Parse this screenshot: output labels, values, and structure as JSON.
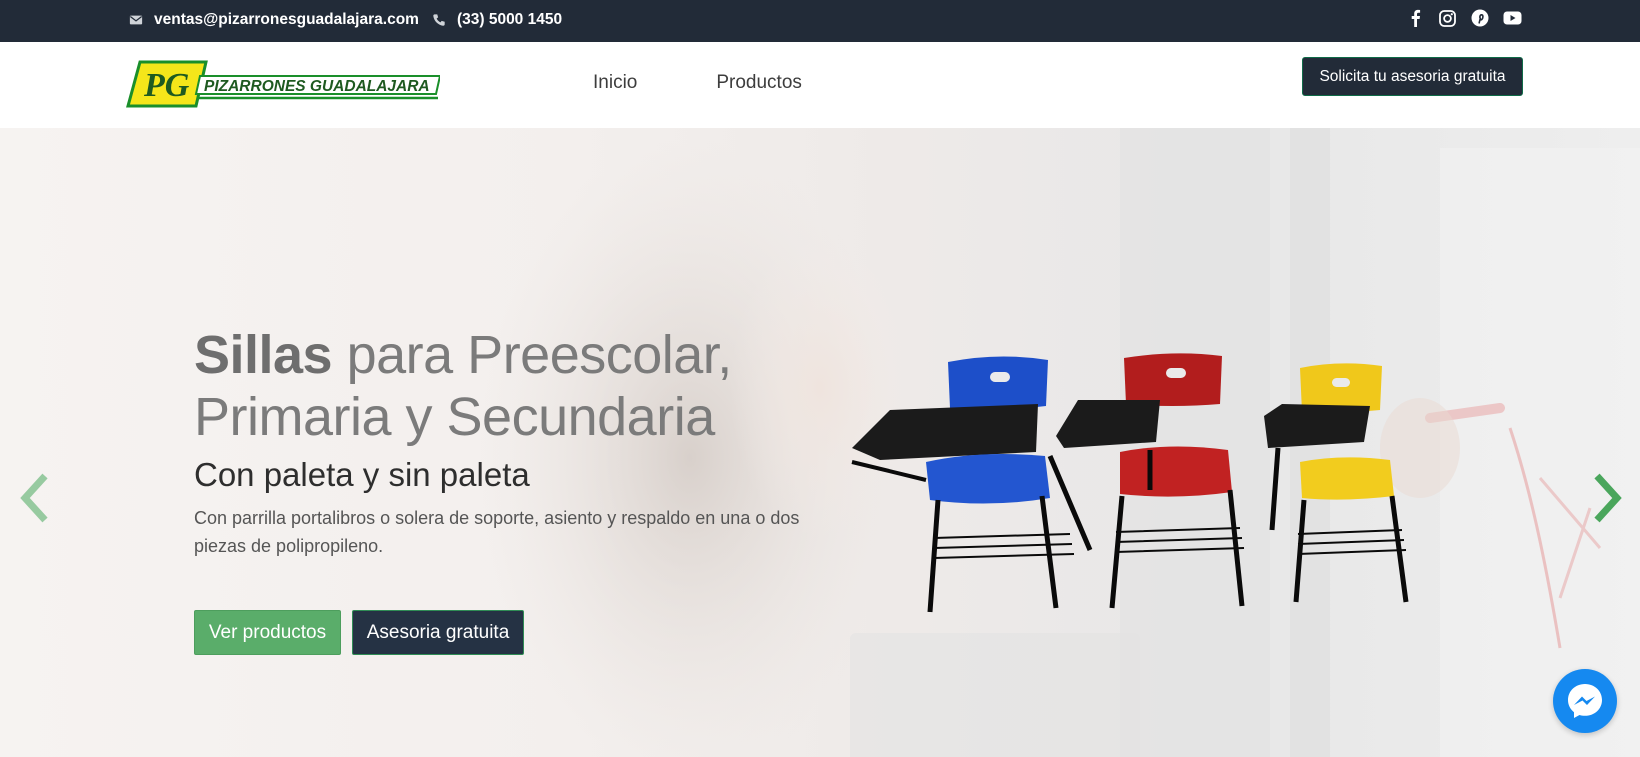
{
  "topbar": {
    "email": "ventas@pizarronesguadalajara.com",
    "phone": "(33) 5000 1450",
    "social": [
      "facebook-icon",
      "instagram-icon",
      "pinterest-icon",
      "youtube-icon"
    ]
  },
  "header": {
    "logo_text": "PIZARRONES GUADALAJARA",
    "logo_mark": "PG",
    "nav": [
      {
        "label": "Inicio"
      },
      {
        "label": "Productos"
      }
    ],
    "cta_label": "Solicita tu asesoria gratuita"
  },
  "hero": {
    "title_strong": "Sillas",
    "title_rest": " para Preescolar, Primaria y Secundaria",
    "subtitle": "Con paleta y sin paleta",
    "description": "Con parrilla portalibros o solera de soporte, asiento y respaldo en una o dos piezas de polipropileno.",
    "primary_button": "Ver productos",
    "secondary_button": "Asesoria gratuita",
    "chair_colors": [
      "#1d4fc9",
      "#b21d1d",
      "#f0c81b"
    ]
  },
  "colors": {
    "topbar": "#222b38",
    "accent_green": "#5aad6a",
    "dark_button": "#253244",
    "messenger": "#1589f0"
  }
}
